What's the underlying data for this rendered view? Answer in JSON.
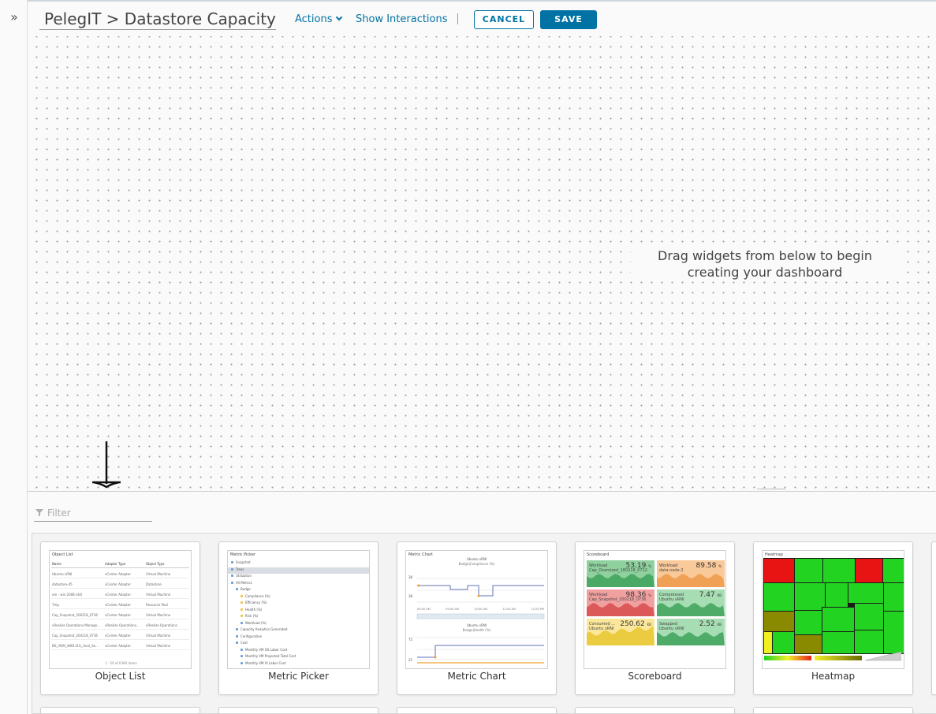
{
  "nav": {
    "toggle_glyph": "»",
    "toggle_icon": "double-chevron-right-icon"
  },
  "header": {
    "title": "PelegIT > Datastore Capacity",
    "actions_label": "Actions",
    "show_interactions_label": "Show Interactions",
    "cancel_label": "CANCEL",
    "save_label": "SAVE"
  },
  "canvas": {
    "empty_message_line1": "Drag widgets from below to begin",
    "empty_message_line2": "creating your dashboard"
  },
  "library": {
    "filter_placeholder": "Filter",
    "filter_value": "",
    "widgets": [
      {
        "label": "Object List",
        "thumb_title": "Object List",
        "columns": [
          "Name",
          "Adapter Type",
          "Object Type"
        ],
        "rows": [
          [
            "Ubuntu vRNI",
            "vCenter Adapter",
            "Virtual Machine"
          ],
          [
            "datastore-45",
            "vCenter Adapter",
            "Datastore"
          ],
          [
            "em - win 2008 (dd)",
            "vCenter Adapter",
            "Virtual Machine"
          ],
          [
            "Tmp",
            "vCenter Adapter",
            "Resource Pool"
          ],
          [
            "Cap_Snapshot_200218_0736",
            "vCenter Adapter",
            "Virtual Machine"
          ],
          [
            "vRealize Operations Manage...",
            "vRealize Operations...",
            "vRealize Operations"
          ],
          [
            "Cap_Snapshot_200218_0736",
            "vCenter Adapter",
            "Virtual Machine"
          ],
          [
            "NS_VDM_4891316_clust_Se...",
            "vCenter Adapter",
            "Virtual Machine"
          ]
        ],
        "pager": "1 - 50 of 6380 items"
      },
      {
        "label": "Metric Picker",
        "thumb_title": "Metric Picker",
        "items": [
          "Snapshot",
          "Trees",
          "Utilization",
          "All Metrics",
          "Badge",
          "Compliance (%)",
          "Efficiency (%)",
          "Health (%)",
          "Risk (%)",
          "Workload (%)",
          "Capacity Analytics Generated",
          "Configuration",
          "Cost",
          "Monthly VM OS Labor Cost",
          "Monthly VM Projected Total Cost",
          "Monthly VM VI Labor Cost"
        ]
      },
      {
        "label": "Metric Chart",
        "thumb_title": "Metric Chart",
        "chart1_title": "Ubuntu vRNI",
        "chart1_sub": "Badge|Compliance (%)",
        "chart1_hi": "38",
        "chart1_lo": "38",
        "chart1_times": [
          "09:00 AM",
          "09:00 AM",
          "10:00 AM",
          "11:00 AM",
          "12:00 PM"
        ],
        "chart2_title": "Ubuntu vRNI",
        "chart2_sub": "Badge|Health (%)",
        "chart2_hi": "75",
        "chart2_lo": "25"
      },
      {
        "label": "Scoreboard",
        "thumb_title": "Scoreboard",
        "tiles": [
          {
            "name": "Workload\nCap_Oversized_180218_0712",
            "value": "53.19",
            "unit": "%",
            "color": "#8fd19e"
          },
          {
            "name": "Workload\ndata-node-2",
            "value": "89.58",
            "unit": "%",
            "color": "#f9c99a"
          },
          {
            "name": "Workload\nCap_Snapshot_200218_0736",
            "value": "98.36",
            "unit": "%",
            "color": "#f1a0a0"
          },
          {
            "name": "Compressed\nUbuntu vRNI",
            "value": "7.47",
            "unit": "KB",
            "color": "#a7ddb3"
          },
          {
            "name": "Consumed ...\nUbuntu vRNI",
            "value": "250.62",
            "unit": "KB",
            "color": "#fbe79a"
          },
          {
            "name": "Swapped\nUbuntu vRNI",
            "value": "2.52",
            "unit": "KB",
            "color": "#a7ddb3"
          }
        ]
      },
      {
        "label": "Heatmap",
        "thumb_title": "Heatmap"
      }
    ]
  }
}
